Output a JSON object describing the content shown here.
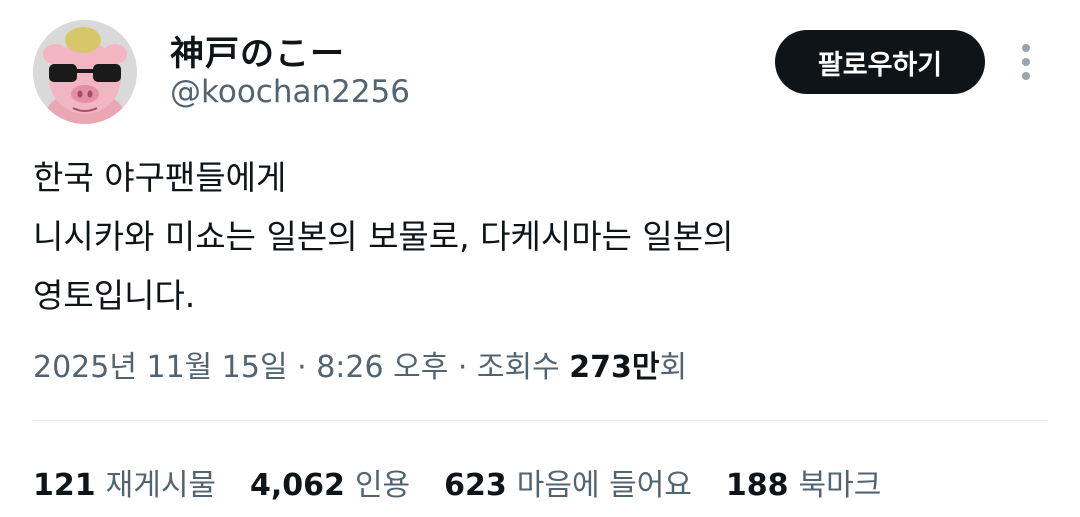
{
  "user": {
    "display_name": "神戸のこー",
    "handle": "@koochan2256"
  },
  "actions": {
    "follow_label": "팔로우하기",
    "more_icon": "more-vertical-icon"
  },
  "tweet": {
    "lines": [
      "한국 야구팬들에게",
      "니시카와 미쇼는 일본의 보물로, 다케시마는 일본의",
      "영토입니다."
    ]
  },
  "meta": {
    "date": "2025년 11월 15일",
    "sep1": " · ",
    "time": "8:26 오후",
    "sep2": " · ",
    "views_prefix": "조회수 ",
    "views_count": "273만",
    "views_suffix": "회"
  },
  "stats": [
    {
      "count": "121",
      "label": "재게시물"
    },
    {
      "count": "4,062",
      "label": "인용"
    },
    {
      "count": "623",
      "label": "마음에 들어요"
    },
    {
      "count": "188",
      "label": "북마크"
    }
  ]
}
